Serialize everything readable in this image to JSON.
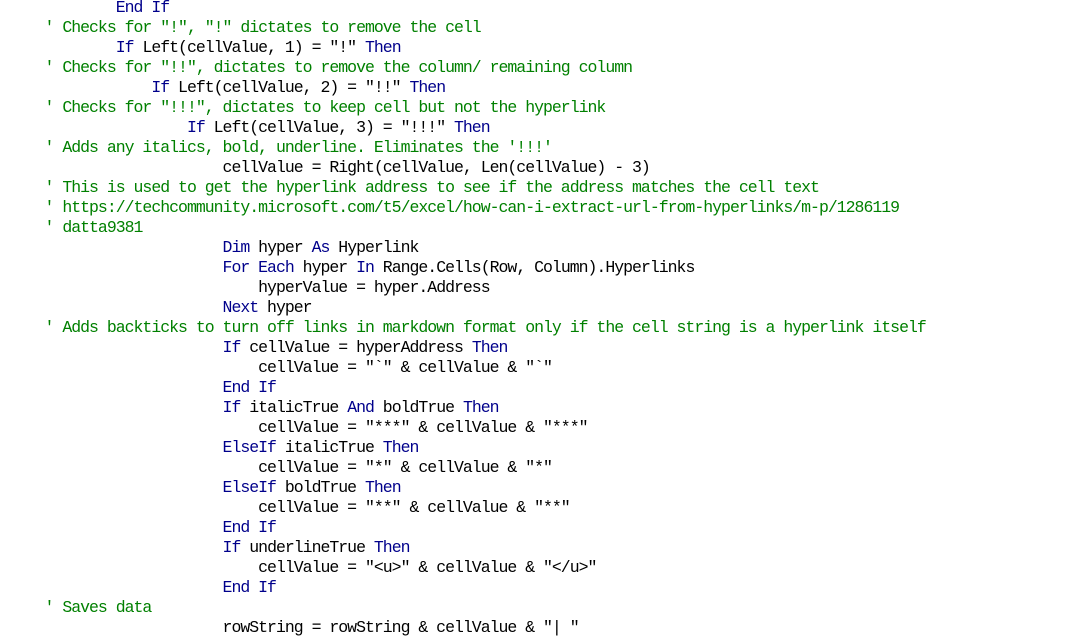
{
  "editor": {
    "language": "VBA",
    "colors": {
      "keyword": "#00008b",
      "comment": "#008000",
      "text": "#000000",
      "background": "#ffffff"
    },
    "lines": [
      {
        "indent": 13,
        "segments": [
          {
            "type": "kw",
            "text": "End If"
          }
        ]
      },
      {
        "indent": 5,
        "segments": [
          {
            "type": "comment",
            "text": "' Checks for \"!\", \"!\" dictates to remove the cell"
          }
        ]
      },
      {
        "indent": 13,
        "segments": [
          {
            "type": "kw",
            "text": "If"
          },
          {
            "type": "plain",
            "text": " Left(cellValue, 1) = \"!\" "
          },
          {
            "type": "kw",
            "text": "Then"
          }
        ]
      },
      {
        "indent": 5,
        "segments": [
          {
            "type": "comment",
            "text": "' Checks for \"!!\", dictates to remove the column/ remaining column"
          }
        ]
      },
      {
        "indent": 17,
        "segments": [
          {
            "type": "kw",
            "text": "If"
          },
          {
            "type": "plain",
            "text": " Left(cellValue, 2) = \"!!\" "
          },
          {
            "type": "kw",
            "text": "Then"
          }
        ]
      },
      {
        "indent": 5,
        "segments": [
          {
            "type": "comment",
            "text": "' Checks for \"!!!\", dictates to keep cell but not the hyperlink"
          }
        ]
      },
      {
        "indent": 21,
        "segments": [
          {
            "type": "kw",
            "text": "If"
          },
          {
            "type": "plain",
            "text": " Left(cellValue, 3) = \"!!!\" "
          },
          {
            "type": "kw",
            "text": "Then"
          }
        ]
      },
      {
        "indent": 5,
        "segments": [
          {
            "type": "comment",
            "text": "' Adds any italics, bold, underline. Eliminates the '!!!'"
          }
        ]
      },
      {
        "indent": 25,
        "segments": [
          {
            "type": "plain",
            "text": "cellValue = Right(cellValue, Len(cellValue) - 3)"
          }
        ]
      },
      {
        "indent": 5,
        "segments": [
          {
            "type": "comment",
            "text": "' This is used to get the hyperlink address to see if the address matches the cell text"
          }
        ]
      },
      {
        "indent": 5,
        "segments": [
          {
            "type": "comment",
            "text": "' https://techcommunity.microsoft.com/t5/excel/how-can-i-extract-url-from-hyperlinks/m-p/1286119"
          }
        ]
      },
      {
        "indent": 5,
        "segments": [
          {
            "type": "comment",
            "text": "' datta9381"
          }
        ]
      },
      {
        "indent": 25,
        "segments": [
          {
            "type": "kw",
            "text": "Dim"
          },
          {
            "type": "plain",
            "text": " hyper "
          },
          {
            "type": "kw",
            "text": "As"
          },
          {
            "type": "plain",
            "text": " Hyperlink"
          }
        ]
      },
      {
        "indent": 25,
        "segments": [
          {
            "type": "kw",
            "text": "For Each"
          },
          {
            "type": "plain",
            "text": " hyper "
          },
          {
            "type": "kw",
            "text": "In"
          },
          {
            "type": "plain",
            "text": " Range.Cells(Row, Column).Hyperlinks"
          }
        ]
      },
      {
        "indent": 29,
        "segments": [
          {
            "type": "plain",
            "text": "hyperValue = hyper.Address"
          }
        ]
      },
      {
        "indent": 25,
        "segments": [
          {
            "type": "kw",
            "text": "Next"
          },
          {
            "type": "plain",
            "text": " hyper"
          }
        ]
      },
      {
        "indent": 5,
        "segments": [
          {
            "type": "comment",
            "text": "' Adds backticks to turn off links in markdown format only if the cell string is a hyperlink itself"
          }
        ]
      },
      {
        "indent": 25,
        "segments": [
          {
            "type": "kw",
            "text": "If"
          },
          {
            "type": "plain",
            "text": " cellValue = hyperAddress "
          },
          {
            "type": "kw",
            "text": "Then"
          }
        ]
      },
      {
        "indent": 29,
        "segments": [
          {
            "type": "plain",
            "text": "cellValue = \"`\" & cellValue & \"`\""
          }
        ]
      },
      {
        "indent": 25,
        "segments": [
          {
            "type": "kw",
            "text": "End If"
          }
        ]
      },
      {
        "indent": 25,
        "segments": [
          {
            "type": "kw",
            "text": "If"
          },
          {
            "type": "plain",
            "text": " italicTrue "
          },
          {
            "type": "kw",
            "text": "And"
          },
          {
            "type": "plain",
            "text": " boldTrue "
          },
          {
            "type": "kw",
            "text": "Then"
          }
        ]
      },
      {
        "indent": 29,
        "segments": [
          {
            "type": "plain",
            "text": "cellValue = \"***\" & cellValue & \"***\""
          }
        ]
      },
      {
        "indent": 25,
        "segments": [
          {
            "type": "kw",
            "text": "ElseIf"
          },
          {
            "type": "plain",
            "text": " italicTrue "
          },
          {
            "type": "kw",
            "text": "Then"
          }
        ]
      },
      {
        "indent": 29,
        "segments": [
          {
            "type": "plain",
            "text": "cellValue = \"*\" & cellValue & \"*\""
          }
        ]
      },
      {
        "indent": 25,
        "segments": [
          {
            "type": "kw",
            "text": "ElseIf"
          },
          {
            "type": "plain",
            "text": " boldTrue "
          },
          {
            "type": "kw",
            "text": "Then"
          }
        ]
      },
      {
        "indent": 29,
        "segments": [
          {
            "type": "plain",
            "text": "cellValue = \"**\" & cellValue & \"**\""
          }
        ]
      },
      {
        "indent": 25,
        "segments": [
          {
            "type": "kw",
            "text": "End If"
          }
        ]
      },
      {
        "indent": 25,
        "segments": [
          {
            "type": "kw",
            "text": "If"
          },
          {
            "type": "plain",
            "text": " underlineTrue "
          },
          {
            "type": "kw",
            "text": "Then"
          }
        ]
      },
      {
        "indent": 29,
        "segments": [
          {
            "type": "plain",
            "text": "cellValue = \"<u>\" & cellValue & \"</u>\""
          }
        ]
      },
      {
        "indent": 25,
        "segments": [
          {
            "type": "kw",
            "text": "End If"
          }
        ]
      },
      {
        "indent": 5,
        "segments": [
          {
            "type": "comment",
            "text": "' Saves data"
          }
        ]
      },
      {
        "indent": 25,
        "segments": [
          {
            "type": "plain",
            "text": "rowString = rowString & cellValue & \"| \""
          }
        ]
      }
    ]
  }
}
